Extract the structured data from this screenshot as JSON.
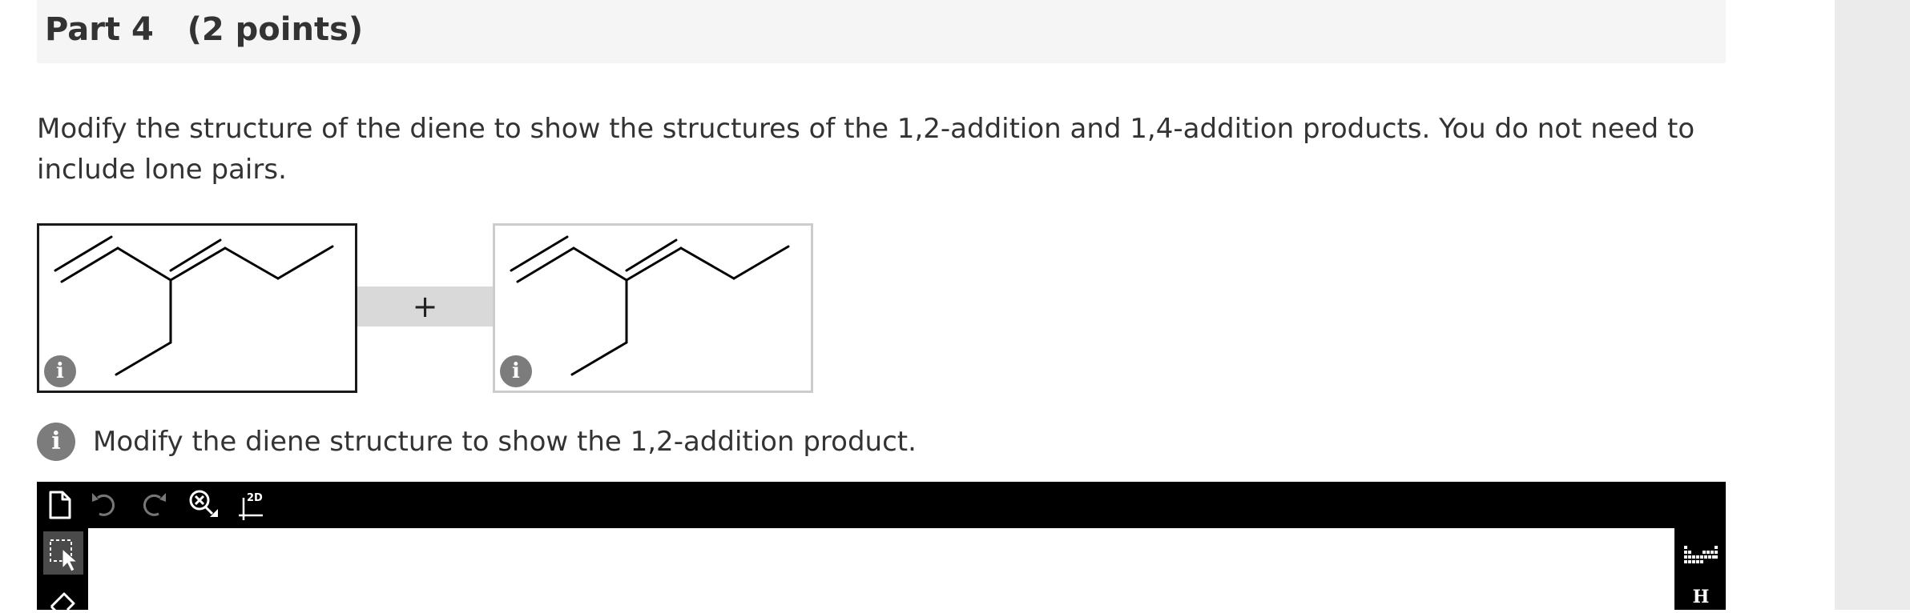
{
  "part": {
    "title": "Part 4   (2 points)"
  },
  "question": {
    "instruction": "Modify the structure of the diene to show the structures of the 1,2-addition and 1,4-addition products. You do not need to include lone pairs."
  },
  "answer_boxes": [
    {
      "state": "selected",
      "info_icon": "i"
    },
    {
      "state": "unselected",
      "info_icon": "i"
    }
  ],
  "separator": {
    "plus": "+"
  },
  "hint": {
    "icon": "i",
    "text": "Modify the diene structure to show the 1,2-addition product."
  },
  "editor": {
    "toolbar": {
      "tools": [
        "new-document-icon",
        "undo-icon",
        "redo-icon",
        "clear-zoom-icon",
        "2d-coordinates-icon"
      ],
      "two_d_label": "2D"
    },
    "left_tools": [
      "select-tool-icon",
      "eraser-icon"
    ],
    "right_tools": {
      "periodic_table": "periodic-table-icon",
      "atom_h": "H"
    }
  },
  "colors": {
    "header_bg": "#f5f5f5",
    "toolbar_bg": "#000000",
    "gutter_bg": "#ebebeb",
    "selected_border": "#1a1a1a",
    "unselected_border": "#cccccc",
    "info_icon": "#7c7c7c"
  }
}
